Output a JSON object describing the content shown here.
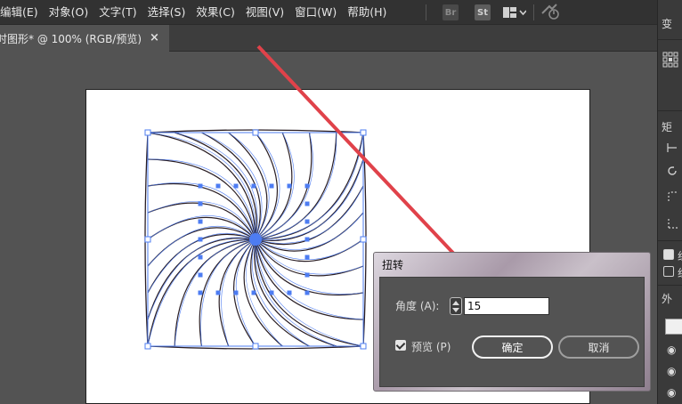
{
  "menubar": {
    "items": [
      {
        "label": "编辑(E)"
      },
      {
        "label": "对象(O)"
      },
      {
        "label": "文字(T)"
      },
      {
        "label": "选择(S)"
      },
      {
        "label": "效果(C)"
      },
      {
        "label": "视图(V)"
      },
      {
        "label": "窗口(W)"
      },
      {
        "label": "帮助(H)"
      }
    ],
    "bridge_label": "Br",
    "stock_label": "St",
    "arrange_icon": "arrange-documents-icon",
    "gpu_icon": "gpu-performance-icon"
  },
  "document_tab": {
    "title": "时图形* @ 100% (RGB/预览)",
    "close": "×"
  },
  "right_panel": {
    "header": "变",
    "section_label": "矩",
    "appearance_label": "外",
    "checkbox_1_label": "组",
    "checkbox_2_label": "组"
  },
  "twist_dialog": {
    "title": "扭转",
    "angle_label": "角度 (A):",
    "angle_value": "15",
    "preview_label": "预览 (P)",
    "preview_checked": true,
    "ok_label": "确定",
    "cancel_label": "取消"
  },
  "colors": {
    "selection": "#4d7cf2",
    "annotation_arrow": "#e0424a",
    "stroke": "#2a1e24"
  }
}
